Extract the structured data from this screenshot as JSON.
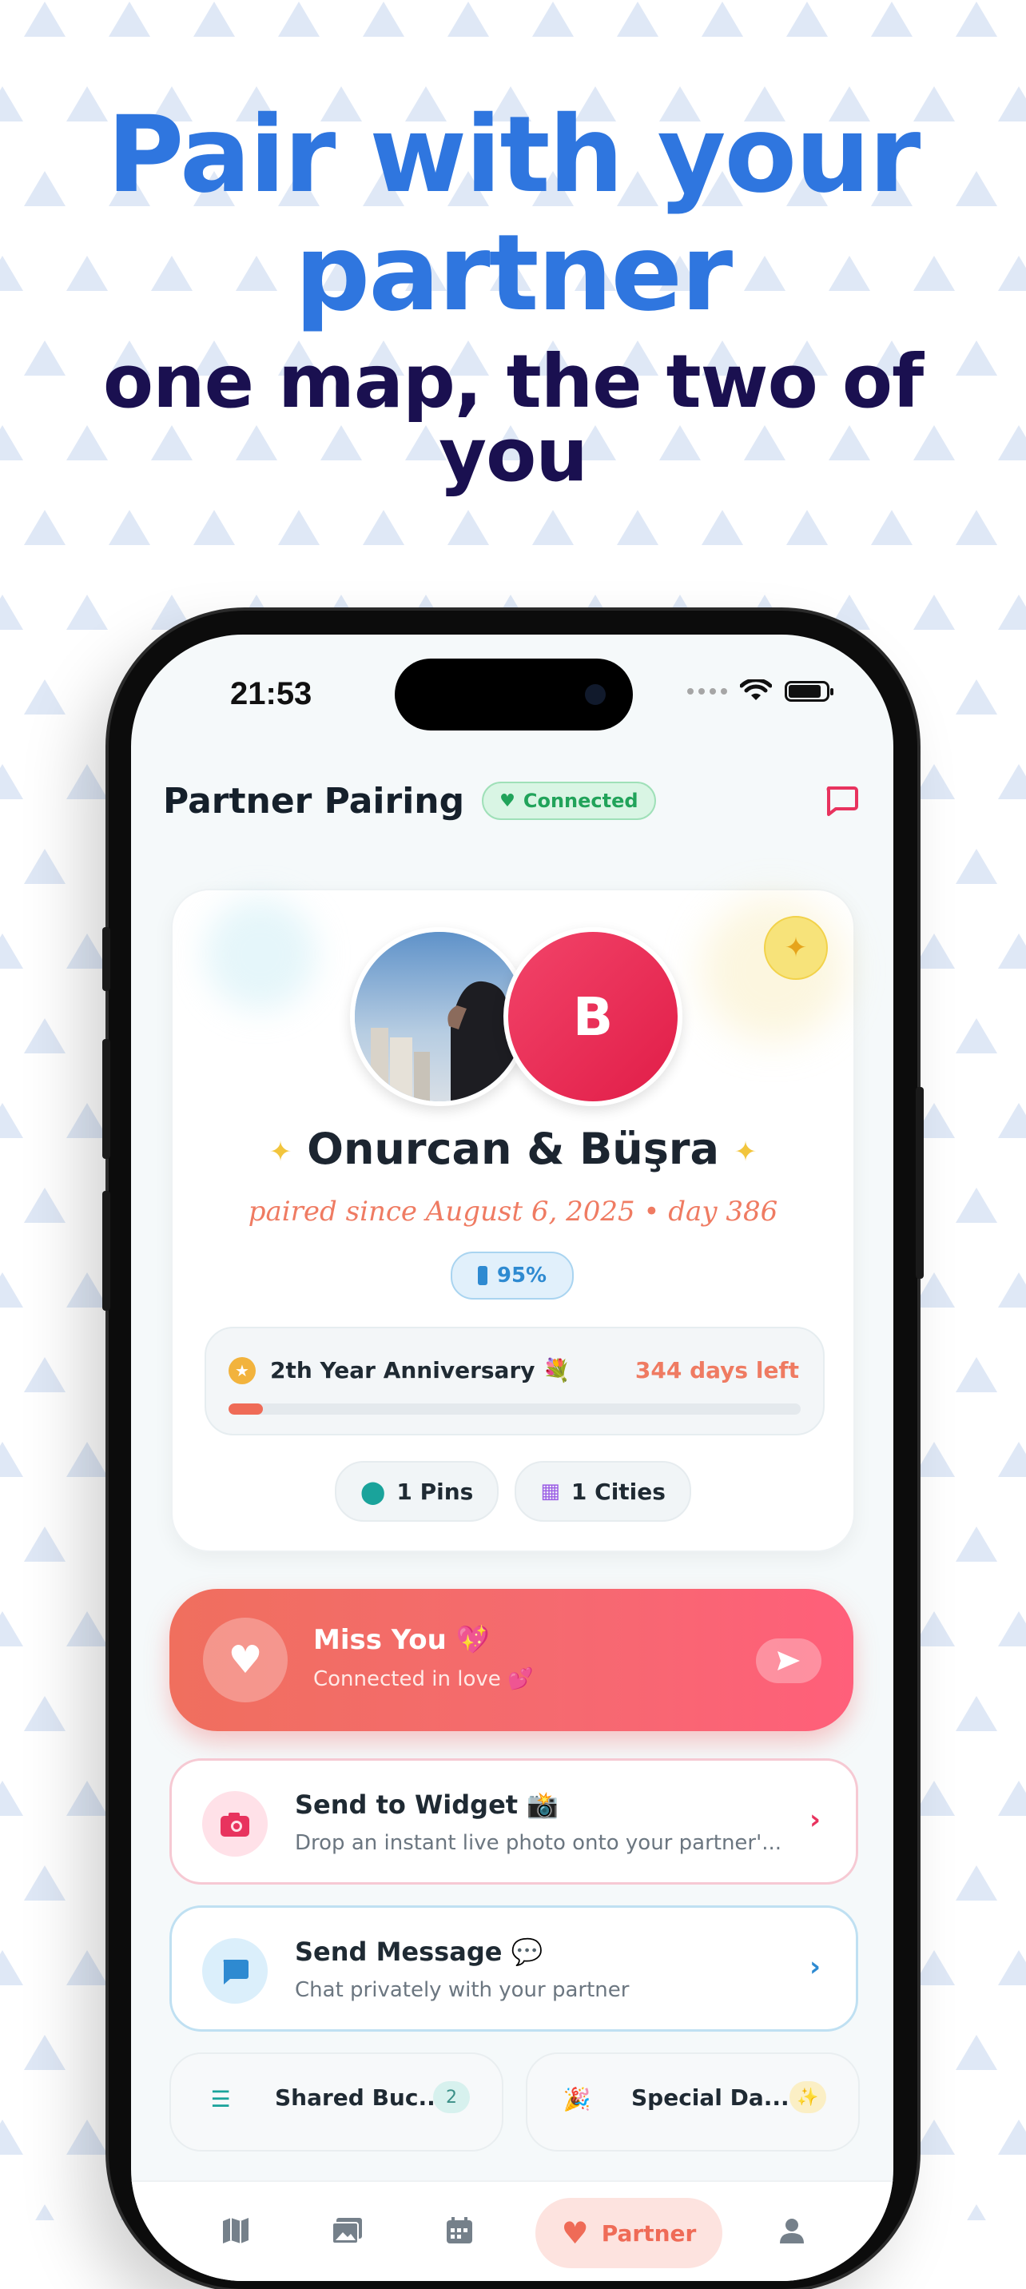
{
  "headline": {
    "line1": "Pair with your",
    "line2": "partner",
    "subline1": "one map, the two of",
    "subline2": "you"
  },
  "status_bar": {
    "time": "21:53"
  },
  "header": {
    "title": "Partner Pairing",
    "badge": "Connected"
  },
  "couple_card": {
    "avatar_initial": "B",
    "names": "Onurcan & Büşra",
    "paired_since": "paired since August 6, 2025 • day 386",
    "battery": "95%",
    "anniversary": {
      "label": "2th Year Anniversary 💐",
      "days_left": "344 days left",
      "progress": 0.06
    },
    "stats": {
      "pins": "1 Pins",
      "cities": "1 Cities"
    }
  },
  "miss_you": {
    "title": "Miss You 💖",
    "subtitle": "Connected in love 💕"
  },
  "send_widget": {
    "title": "Send to Widget 📸",
    "subtitle": "Drop an instant live photo onto your partner'..."
  },
  "send_message": {
    "title": "Send Message 💬",
    "subtitle": "Chat privately with your partner"
  },
  "mini_cards": {
    "bucket": {
      "label": "Shared Buc...",
      "count": "2"
    },
    "special": {
      "label": "Special Da...",
      "badge": "✨"
    }
  },
  "tabbar": {
    "active_label": "Partner",
    "icons": [
      "map-icon",
      "gallery-icon",
      "calendar-icon",
      "heart-icon",
      "profile-icon"
    ]
  },
  "colors": {
    "headline_blue": "#2f76df",
    "headline_navy": "#1a1050",
    "accent_coral": "#ef6b57",
    "accent_pink": "#e8335e",
    "connected_green": "#21a35a"
  }
}
